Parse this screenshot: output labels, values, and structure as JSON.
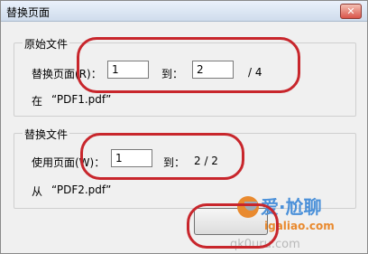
{
  "dialog": {
    "title": "替换页面",
    "close_glyph": "✕"
  },
  "original": {
    "legend": "原始文件",
    "replace_label": "替换页面(R)：",
    "from_value": "1",
    "to_label": "到：",
    "to_value": "2",
    "total": "/ 4",
    "in_label": "在",
    "file": "“PDF1.pdf”"
  },
  "replacement": {
    "legend": "替换文件",
    "use_label": "使用页面(W)：",
    "from_value": "1",
    "to_label": "到：",
    "range_text": "2 / 2",
    "from_label": "从",
    "file": "“PDF2.pdf”"
  },
  "watermark": {
    "text_main": "爱·尬聊",
    "text_sub": "igaliao.com",
    "text_domain": "qk0uru.com",
    "brand_color": "#e98a2f",
    "accent_color": "#4a90d9"
  },
  "annotation_color": "#c8262c"
}
